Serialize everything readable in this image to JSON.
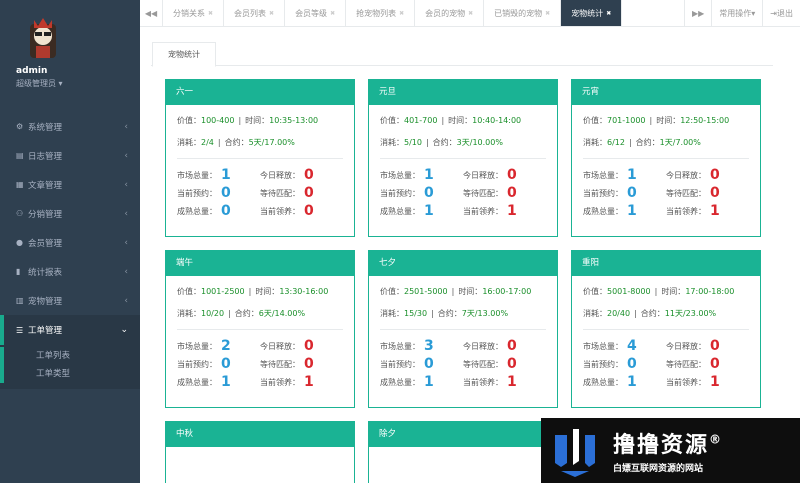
{
  "profile": {
    "name": "admin",
    "role": "超级管理员"
  },
  "sidebar": {
    "items": [
      {
        "label": "系统管理"
      },
      {
        "label": "日志管理"
      },
      {
        "label": "文章管理"
      },
      {
        "label": "分销管理"
      },
      {
        "label": "会员管理"
      },
      {
        "label": "统计报表"
      },
      {
        "label": "宠物管理"
      },
      {
        "label": "工单管理"
      }
    ],
    "sub": [
      "工单列表",
      "工单类型"
    ]
  },
  "tabs": [
    "分销关系",
    "会员列表",
    "会员等级",
    "抢宠物列表",
    "会员的宠物",
    "已销毁的宠物",
    "宠物统计"
  ],
  "toolbar": {
    "ops": "常用操作",
    "logout": "退出"
  },
  "page_tab": "宠物统计",
  "labels": {
    "value": "价值：",
    "time": "时间：",
    "cost": "消耗：",
    "contract": "合约：",
    "market": "市场总量：",
    "release": "今日释放：",
    "reserve": "当前预约：",
    "waiting": "等待匹配：",
    "mature": "成熟总量：",
    "adopt": "当前领养："
  },
  "cards": [
    {
      "name": "六一",
      "value": "100-400",
      "time": "10:35-13:00",
      "cost": "2/4",
      "contract": "5天/17.00%",
      "market": "1",
      "release": "0",
      "reserve": "0",
      "waiting": "0",
      "mature": "0",
      "adopt": "0"
    },
    {
      "name": "元旦",
      "value": "401-700",
      "time": "10:40-14:00",
      "cost": "5/10",
      "contract": "3天/10.00%",
      "market": "1",
      "release": "0",
      "reserve": "0",
      "waiting": "0",
      "mature": "1",
      "adopt": "1"
    },
    {
      "name": "元宵",
      "value": "701-1000",
      "time": "12:50-15:00",
      "cost": "6/12",
      "contract": "1天/7.00%",
      "market": "1",
      "release": "0",
      "reserve": "0",
      "waiting": "0",
      "mature": "1",
      "adopt": "1"
    },
    {
      "name": "端午",
      "value": "1001-2500",
      "time": "13:30-16:00",
      "cost": "10/20",
      "contract": "6天/14.00%",
      "market": "2",
      "release": "0",
      "reserve": "0",
      "waiting": "0",
      "mature": "1",
      "adopt": "1"
    },
    {
      "name": "七夕",
      "value": "2501-5000",
      "time": "16:00-17:00",
      "cost": "15/30",
      "contract": "7天/13.00%",
      "market": "3",
      "release": "0",
      "reserve": "0",
      "waiting": "0",
      "mature": "1",
      "adopt": "1"
    },
    {
      "name": "重阳",
      "value": "5001-8000",
      "time": "17:00-18:00",
      "cost": "20/40",
      "contract": "11天/23.00%",
      "market": "4",
      "release": "0",
      "reserve": "0",
      "waiting": "0",
      "mature": "1",
      "adopt": "1"
    },
    {
      "name": "中秋"
    },
    {
      "name": "除夕"
    }
  ],
  "watermark": {
    "title": "撸撸资源",
    "reg": "®",
    "subtitle": "白嫖互联网资源的网站"
  },
  "colors": {
    "accent": "#1ab394",
    "sidebar": "#2f4050",
    "blue_num": "#2a9bd6",
    "red_num": "#d9272e"
  }
}
